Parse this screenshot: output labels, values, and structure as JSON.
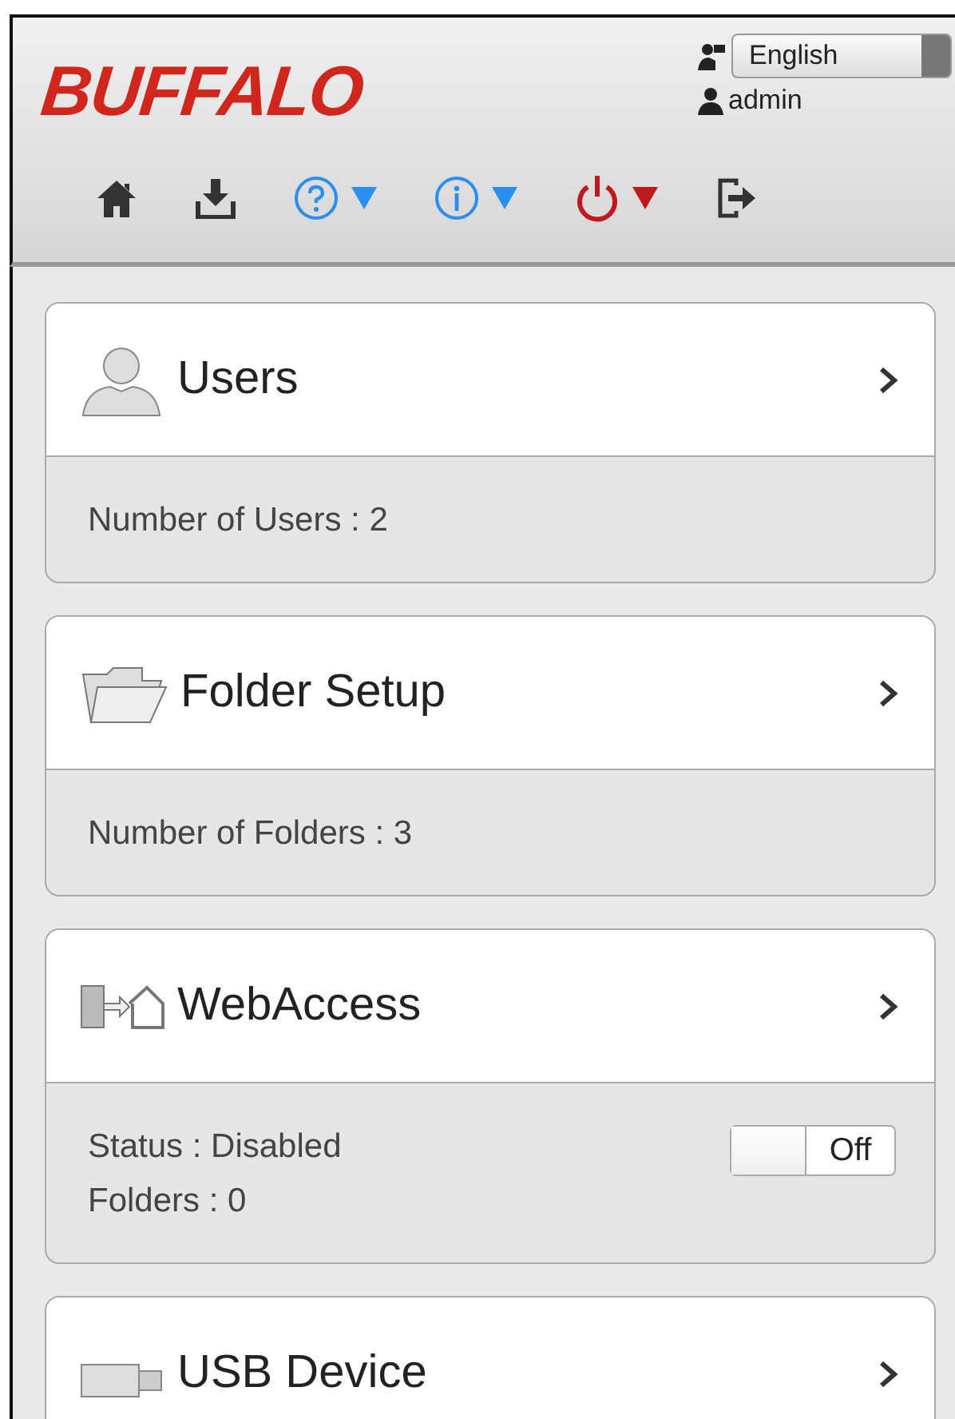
{
  "header": {
    "logo": "BUFFALO",
    "language": "English",
    "user": "admin"
  },
  "toolbar": [
    {
      "kind": "home",
      "menu": false
    },
    {
      "kind": "download",
      "menu": false
    },
    {
      "kind": "help",
      "menu": true
    },
    {
      "kind": "info",
      "menu": true
    },
    {
      "kind": "power",
      "menu": true
    },
    {
      "kind": "logout",
      "menu": false
    }
  ],
  "cards": [
    {
      "kind": "users",
      "title": "Users",
      "lines": [
        "Number of Users : 2"
      ]
    },
    {
      "kind": "folder",
      "title": "Folder Setup",
      "lines": [
        "Number of Folders : 3"
      ]
    },
    {
      "kind": "webaccess",
      "title": "WebAccess",
      "lines": [
        "Status : Disabled",
        "Folders : 0"
      ],
      "toggle": {
        "on": false,
        "label": "Off"
      }
    },
    {
      "kind": "usb",
      "title": "USB Device"
    }
  ]
}
